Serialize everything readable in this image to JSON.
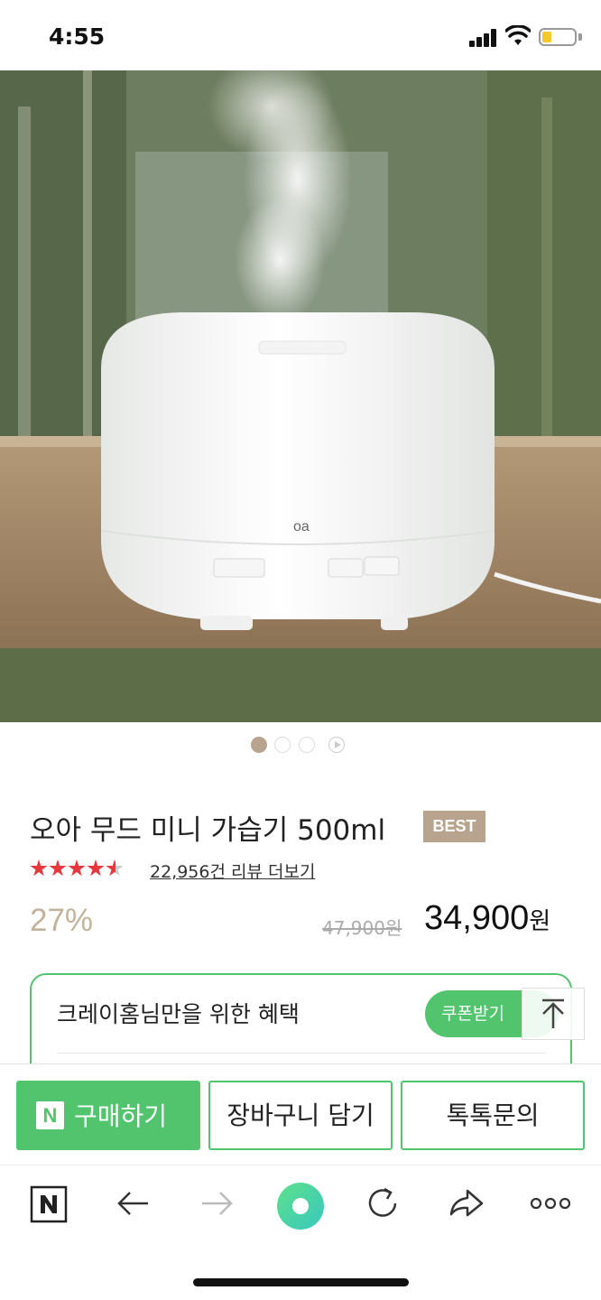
{
  "status_bar": {
    "time": "4:55"
  },
  "hero": {
    "image_alt": "white humidifier on wooden shelf with mist",
    "dots_count": 4,
    "active_dot": 1
  },
  "product": {
    "title": "오아 무드 미니 가습기 500ml",
    "badge": "BEST",
    "rating_stars": 4.5,
    "review_link": "22,956건 리뷰 더보기",
    "discount": "27%",
    "original_price": "47,900원",
    "price_number": "34,900",
    "price_unit": "원"
  },
  "benefit": {
    "title": "크레이홈님만을 위한 혜택",
    "coupon_label": "쿠폰받기"
  },
  "action_bar": {
    "naver_logo": "N",
    "buy_label": "구매하기",
    "cart_label": "장바구니 담기",
    "talk_label": "톡톡문의"
  },
  "colors": {
    "brand_green": "#52c46e",
    "badge_beige": "#b8a48e",
    "star_red": "#e8383d"
  },
  "toolbar_icons": [
    "naver-home-icon",
    "back-arrow-icon",
    "forward-arrow-icon",
    "green-dot-icon",
    "refresh-icon",
    "share-icon",
    "more-icon"
  ]
}
